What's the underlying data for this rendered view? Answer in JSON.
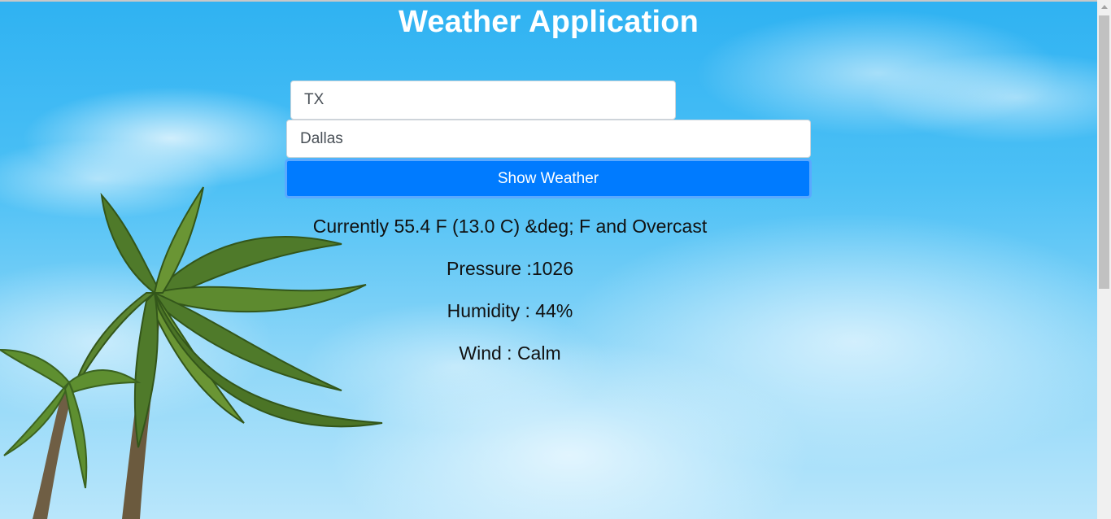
{
  "app": {
    "title": "Weather Application"
  },
  "form": {
    "state_value": "TX",
    "city_value": "Dallas",
    "submit_label": "Show Weather"
  },
  "results": {
    "current": "Currently 55.4 F (13.0 C) &deg; F and Overcast",
    "pressure": "Pressure :1026",
    "humidity": "Humidity : 44%",
    "wind": "Wind : Calm"
  },
  "colors": {
    "button": "#007bff",
    "sky": "#2fb2f2",
    "title": "#ffffff"
  },
  "icons": {
    "background": "palm-tree-sky-image"
  }
}
